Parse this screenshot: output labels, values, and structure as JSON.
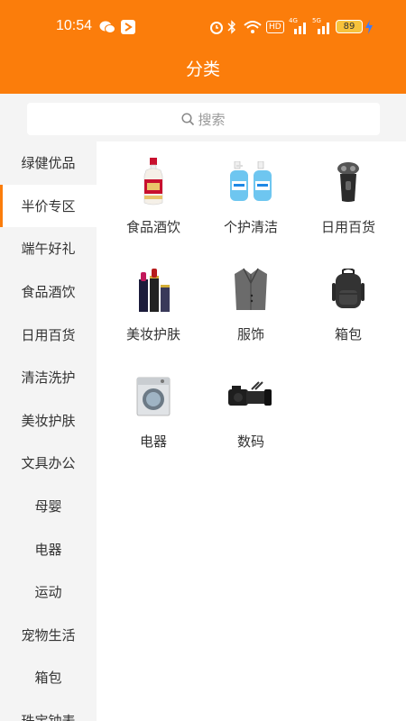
{
  "status_bar": {
    "time": "10:54",
    "hd_badge": "HD",
    "net1": "4G",
    "net2": "5G",
    "battery": "89"
  },
  "header": {
    "title": "分类"
  },
  "search": {
    "placeholder": "搜索"
  },
  "sidebar": {
    "items": [
      {
        "label": "绿健优品"
      },
      {
        "label": "半价专区",
        "active": true
      },
      {
        "label": "端午好礼"
      },
      {
        "label": "食品酒饮"
      },
      {
        "label": "日用百货"
      },
      {
        "label": "清洁洗护"
      },
      {
        "label": "美妆护肤"
      },
      {
        "label": "文具办公"
      },
      {
        "label": "母婴"
      },
      {
        "label": "电器"
      },
      {
        "label": "运动"
      },
      {
        "label": "宠物生活"
      },
      {
        "label": "箱包"
      },
      {
        "label": "珠宝钟表"
      }
    ]
  },
  "categories": [
    {
      "label": "食品酒饮",
      "icon": "liquor-bottle-icon"
    },
    {
      "label": "个护清洁",
      "icon": "soap-bottles-icon"
    },
    {
      "label": "日用百货",
      "icon": "shaver-icon"
    },
    {
      "label": "美妆护肤",
      "icon": "lipstick-icon"
    },
    {
      "label": "服饰",
      "icon": "suit-jacket-icon"
    },
    {
      "label": "箱包",
      "icon": "backpack-icon"
    },
    {
      "label": "电器",
      "icon": "washing-machine-icon"
    },
    {
      "label": "数码",
      "icon": "camera-icon"
    }
  ],
  "colors": {
    "accent": "#fb7d0b",
    "background": "#f4f4f4"
  }
}
